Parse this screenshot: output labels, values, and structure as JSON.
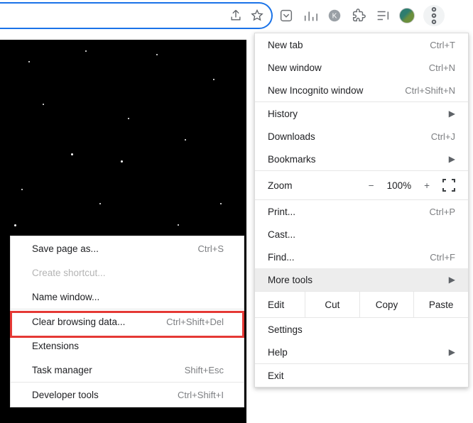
{
  "menu": {
    "newTab": {
      "label": "New tab",
      "shortcut": "Ctrl+T"
    },
    "newWindow": {
      "label": "New window",
      "shortcut": "Ctrl+N"
    },
    "newIncognito": {
      "label": "New Incognito window",
      "shortcut": "Ctrl+Shift+N"
    },
    "history": {
      "label": "History"
    },
    "downloads": {
      "label": "Downloads",
      "shortcut": "Ctrl+J"
    },
    "bookmarks": {
      "label": "Bookmarks"
    },
    "zoom": {
      "label": "Zoom",
      "minus": "−",
      "value": "100%",
      "plus": "+"
    },
    "print": {
      "label": "Print...",
      "shortcut": "Ctrl+P"
    },
    "cast": {
      "label": "Cast..."
    },
    "find": {
      "label": "Find...",
      "shortcut": "Ctrl+F"
    },
    "moreTools": {
      "label": "More tools"
    },
    "edit": {
      "label": "Edit",
      "cut": "Cut",
      "copy": "Copy",
      "paste": "Paste"
    },
    "settings": {
      "label": "Settings"
    },
    "help": {
      "label": "Help"
    },
    "exit": {
      "label": "Exit"
    }
  },
  "submenu": {
    "savePage": {
      "label": "Save page as...",
      "shortcut": "Ctrl+S"
    },
    "createShortcut": {
      "label": "Create shortcut..."
    },
    "nameWindow": {
      "label": "Name window..."
    },
    "clearBrowsing": {
      "label": "Clear browsing data...",
      "shortcut": "Ctrl+Shift+Del"
    },
    "extensions": {
      "label": "Extensions"
    },
    "taskManager": {
      "label": "Task manager",
      "shortcut": "Shift+Esc"
    },
    "devTools": {
      "label": "Developer tools",
      "shortcut": "Ctrl+Shift+I"
    }
  }
}
